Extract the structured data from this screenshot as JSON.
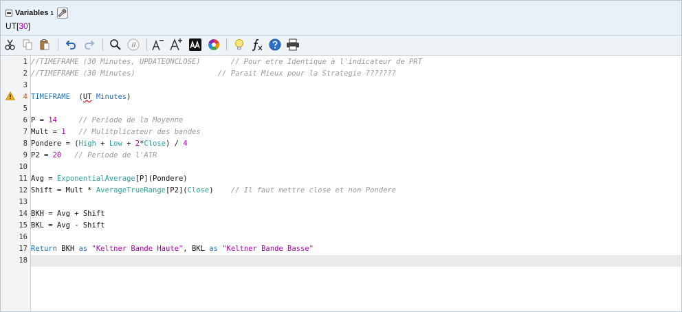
{
  "variables": {
    "title": "Variables",
    "count": "1",
    "line": {
      "name": "UT",
      "open": "[",
      "value": "30",
      "close": "]"
    }
  },
  "toolbar": {
    "icons": [
      "scissors-icon",
      "copy-icon",
      "paste-icon",
      "undo-icon",
      "redo-icon",
      "search-icon",
      "comment-icon",
      "decrease-font-icon",
      "increase-font-icon",
      "text-color-icon",
      "color-wheel-icon",
      "lightbulb-icon",
      "function-icon",
      "help-icon",
      "print-icon"
    ]
  },
  "editor": {
    "line_numbers": [
      "1",
      "2",
      "3",
      "4",
      "5",
      "6",
      "7",
      "8",
      "9",
      "10",
      "11",
      "12",
      "13",
      "14",
      "15",
      "16",
      "17",
      "18"
    ],
    "warning_line": "4",
    "current_line": "18",
    "lines": [
      [
        [
          "cm",
          "//TIMEFRAME (30 Minutes, UPDATEONCLOSE)       // Pour etre Identique à l'indicateur de PRT"
        ]
      ],
      [
        [
          "cm",
          "//TIMEFRAME (30 Minutes)                   // Parait Mieux pour la Strategie ???????"
        ]
      ],
      [],
      [
        [
          "kw",
          "TIMEFRAME"
        ],
        [
          "",
          "  ("
        ],
        [
          "err",
          "UT"
        ],
        [
          "kw",
          " Minutes"
        ],
        [
          "",
          ")"
        ]
      ],
      [],
      [
        [
          "",
          "P = "
        ],
        [
          "nm",
          "14"
        ],
        [
          "",
          "     "
        ],
        [
          "cm",
          "// Periode de la Moyenne"
        ]
      ],
      [
        [
          "",
          "Mult = "
        ],
        [
          "nm",
          "1"
        ],
        [
          "",
          "   "
        ],
        [
          "cm",
          "// Mulitplicateur des bandes"
        ]
      ],
      [
        [
          "",
          "Pondere = ("
        ],
        [
          "fn",
          "High"
        ],
        [
          "",
          " + "
        ],
        [
          "fn",
          "Low"
        ],
        [
          "",
          " + "
        ],
        [
          "nm",
          "2"
        ],
        [
          "",
          "*"
        ],
        [
          "fn",
          "Close"
        ],
        [
          "",
          ") / "
        ],
        [
          "nm",
          "4"
        ]
      ],
      [
        [
          "",
          "P2 = "
        ],
        [
          "nm",
          "20"
        ],
        [
          "",
          "   "
        ],
        [
          "cm",
          "// Periode de l'ATR"
        ]
      ],
      [],
      [
        [
          "",
          "Avg = "
        ],
        [
          "fn",
          "ExponentialAverage"
        ],
        [
          "",
          "[P](Pondere)"
        ]
      ],
      [
        [
          "",
          "Shift = Mult * "
        ],
        [
          "fn",
          "AverageTrueRange"
        ],
        [
          "",
          "[P2]("
        ],
        [
          "fn",
          "Close"
        ],
        [
          "",
          ")    "
        ],
        [
          "cm",
          "// Il faut mettre close et non Pondere"
        ]
      ],
      [],
      [
        [
          "",
          "BKH = Avg + Shift"
        ]
      ],
      [
        [
          "",
          "BKL = Avg - Shift"
        ]
      ],
      [],
      [
        [
          "kw",
          "Return"
        ],
        [
          "",
          " BKH "
        ],
        [
          "kw",
          "as"
        ],
        [
          "",
          " "
        ],
        [
          "st",
          "\"Keltner Bande Haute\""
        ],
        [
          "",
          ", BKL "
        ],
        [
          "kw",
          "as"
        ],
        [
          "",
          " "
        ],
        [
          "st",
          "\"Keltner Bande Basse\""
        ]
      ],
      []
    ]
  }
}
